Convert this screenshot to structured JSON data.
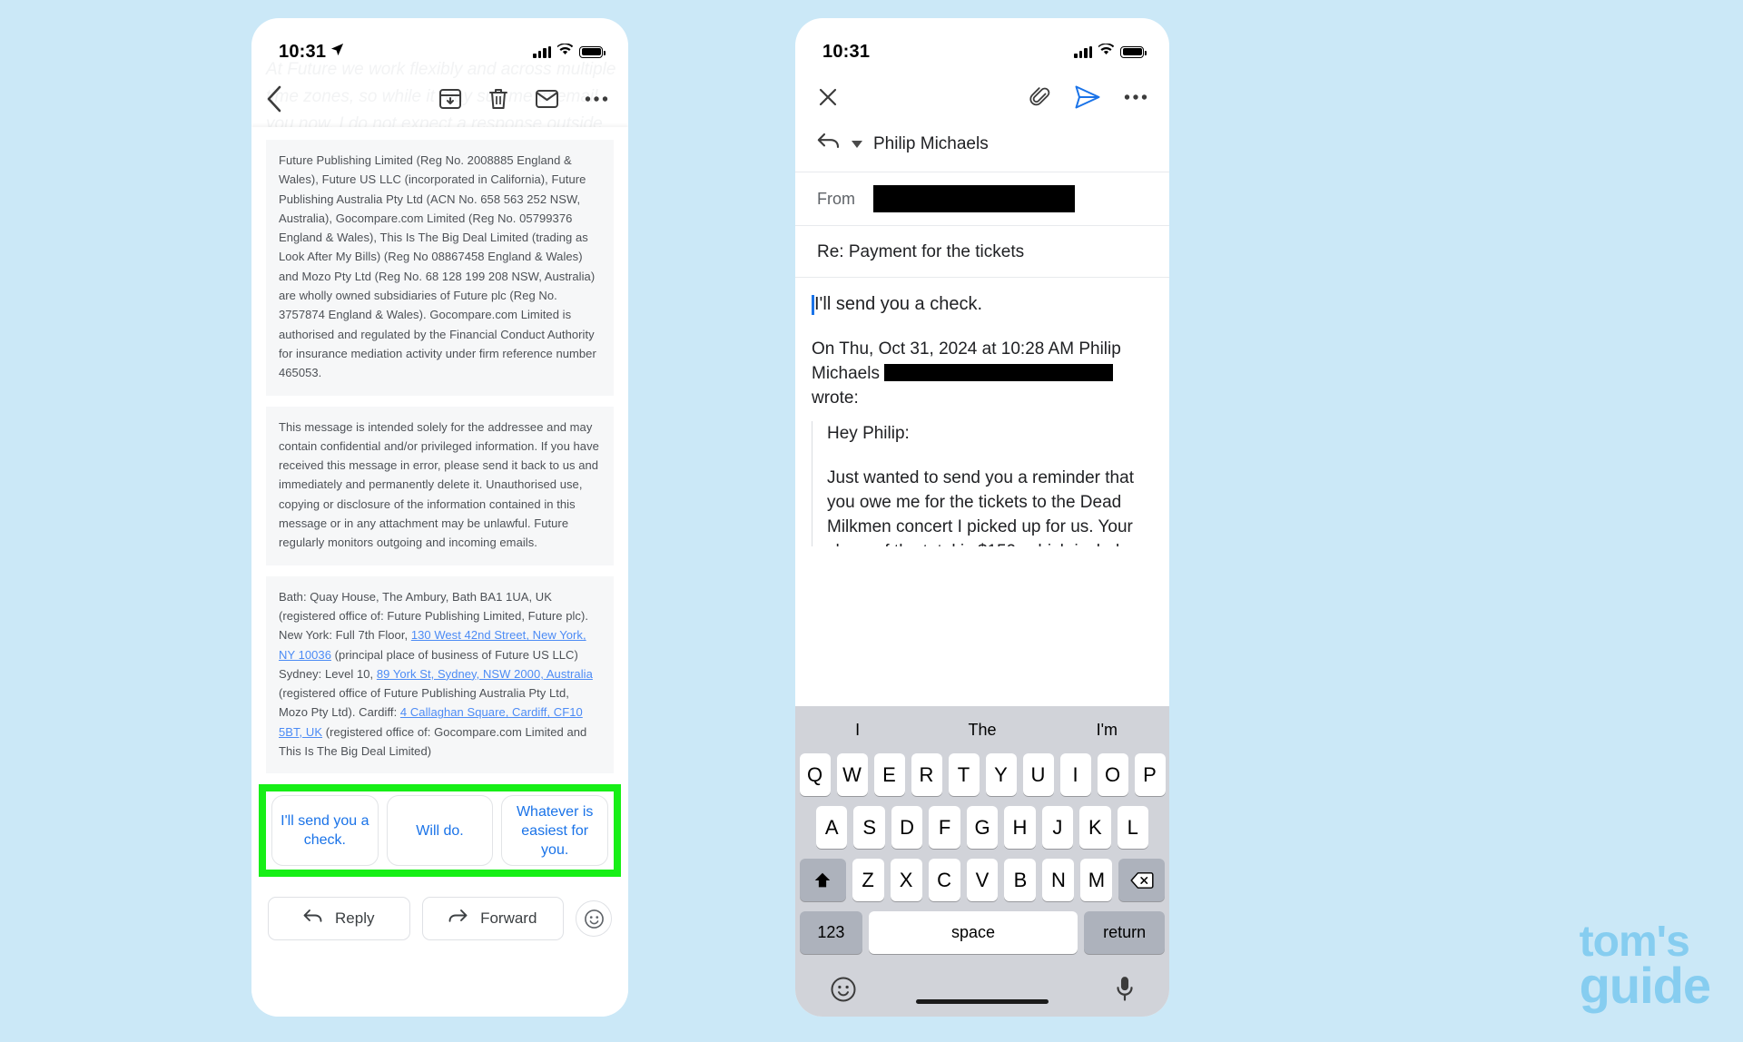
{
  "page": {
    "background_color": "#cbe8f7",
    "highlight_color": "#16ef16",
    "accent_blue": "#1a73e8",
    "link_blue": "#4c8bf5"
  },
  "left_phone": {
    "status": {
      "time": "10:31",
      "location_icon": "location-arrow-icon"
    },
    "ghost_text": "At Future we work flexibly and across multiple time zones, so while it may suit me to email you now, I do not expect a response outside your working hours",
    "toolbar": {
      "back_label": "Back",
      "archive_label": "Archive",
      "delete_label": "Delete",
      "mark_unread_label": "Mark as unread",
      "more_label": "More options"
    },
    "legal_blocks": [
      "Future Publishing Limited (Reg No. 2008885 England & Wales), Future US LLC (incorporated in California), Future Publishing Australia Pty Ltd (ACN No. 658 563 252 NSW, Australia), Gocompare.com Limited (Reg No. 05799376 England & Wales), This Is The Big Deal Limited (trading as Look After My Bills) (Reg No 08867458 England & Wales) and Mozo Pty Ltd (Reg No. 68 128 199 208 NSW, Australia) are wholly owned subsidiaries of Future plc (Reg No. 3757874 England & Wales). Gocompare.com Limited is authorised and regulated by the Financial Conduct Authority for insurance mediation activity under firm reference number 465053.",
      "This message is intended solely for the addressee and may contain confidential and/or privileged information. If you have received this message in error, please send it back to us and immediately and permanently delete it. Unauthorised use, copying or disclosure of the information contained in this message or in any attachment may be unlawful. Future regularly monitors outgoing and incoming emails."
    ],
    "address_block": {
      "part1": "Bath: Quay House, The Ambury, Bath BA1 1UA, UK (registered office of: Future Publishing Limited, Future plc).  New York: Full 7th Floor, ",
      "link1": "130 West 42nd Street, New York, NY 10036",
      "part2": " (principal place of business of Future US LLC) Sydney: Level 10, ",
      "link2": "89 York St,  Sydney, NSW 2000, Australia",
      "part3": " (registered office of Future Publishing Australia Pty Ltd, Mozo Pty Ltd). Cardiff: ",
      "link3": "4 Callaghan Square, Cardiff, CF10 5BT, UK",
      "part4": " (registered office of: Gocompare.com Limited and This Is The Big Deal Limited)"
    },
    "smart_replies": [
      "I'll send you a check.",
      "Will do.",
      "Whatever is easiest for you."
    ],
    "actions": {
      "reply_label": "Reply",
      "forward_label": "Forward",
      "emoji_label": "Emoji reaction"
    }
  },
  "right_phone": {
    "status": {
      "time": "10:31"
    },
    "compose_toolbar": {
      "close_label": "Close",
      "attach_label": "Attach",
      "send_label": "Send",
      "more_label": "More options"
    },
    "reply_to": "Philip Michaels",
    "from_label": "From",
    "from_value_redacted": true,
    "subject": "Re: Payment for the tickets",
    "body_draft": "I'll send you a check.",
    "quote_header_before": "On Thu, Oct 31, 2024 at 10:28 AM Philip Michaels ",
    "quote_header_after": " wrote:",
    "quoted_lines": [
      "Hey Philip:",
      "Just wanted to send you a reminder that you owe me for the tickets to the Dead Milkmen concert I picked up for us. Your share of the total is $150, which includes the convenience fee. (I assume you would have no problem paying for that.) Let me know if you want to send me the money via Apple Cash or just hand over check or cash in"
    ],
    "keyboard": {
      "predictions": [
        "I",
        "The",
        "I'm"
      ],
      "row1": [
        "Q",
        "W",
        "E",
        "R",
        "T",
        "Y",
        "U",
        "I",
        "O",
        "P"
      ],
      "row2": [
        "A",
        "S",
        "D",
        "F",
        "G",
        "H",
        "J",
        "K",
        "L"
      ],
      "row3_shift": "shift-icon",
      "row3": [
        "Z",
        "X",
        "C",
        "V",
        "B",
        "N",
        "M"
      ],
      "row3_backspace": "backspace-icon",
      "numbers_key": "123",
      "space_key": "space",
      "return_key": "return",
      "emoji_key": "emoji-icon",
      "mic_key": "microphone-icon"
    }
  },
  "watermark": {
    "line1": "tom's",
    "line2": "guide"
  }
}
